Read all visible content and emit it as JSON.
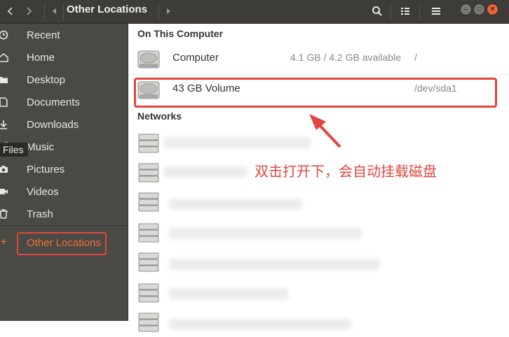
{
  "header": {
    "path_label": "Other Locations"
  },
  "sidebar": {
    "items": [
      {
        "label": "Recent",
        "icon": "clock-icon"
      },
      {
        "label": "Home",
        "icon": "home-icon"
      },
      {
        "label": "Desktop",
        "icon": "folder-icon"
      },
      {
        "label": "Documents",
        "icon": "document-icon"
      },
      {
        "label": "Downloads",
        "icon": "download-icon"
      },
      {
        "label": "Music",
        "icon": "music-icon"
      },
      {
        "label": "Pictures",
        "icon": "camera-icon"
      },
      {
        "label": "Videos",
        "icon": "video-icon"
      },
      {
        "label": "Trash",
        "icon": "trash-icon"
      }
    ],
    "other_locations": {
      "label": "Other Locations",
      "icon": "plus-icon"
    },
    "tooltip": "Files"
  },
  "content": {
    "on_this_computer_title": "On This Computer",
    "devices": [
      {
        "name": "Computer",
        "info": "4.1 GB / 4.2 GB available",
        "mount": "/"
      },
      {
        "name": "43 GB Volume",
        "info": "",
        "mount": "/dev/sda1"
      }
    ],
    "networks_title": "Networks"
  },
  "annotation": {
    "text": "双击打开下，会自动挂载磁盘"
  },
  "colors": {
    "accent": "#e0463f",
    "sidebar_bg": "#4a4944",
    "header_bg": "#3d3c38",
    "active_text": "#f0703d"
  }
}
